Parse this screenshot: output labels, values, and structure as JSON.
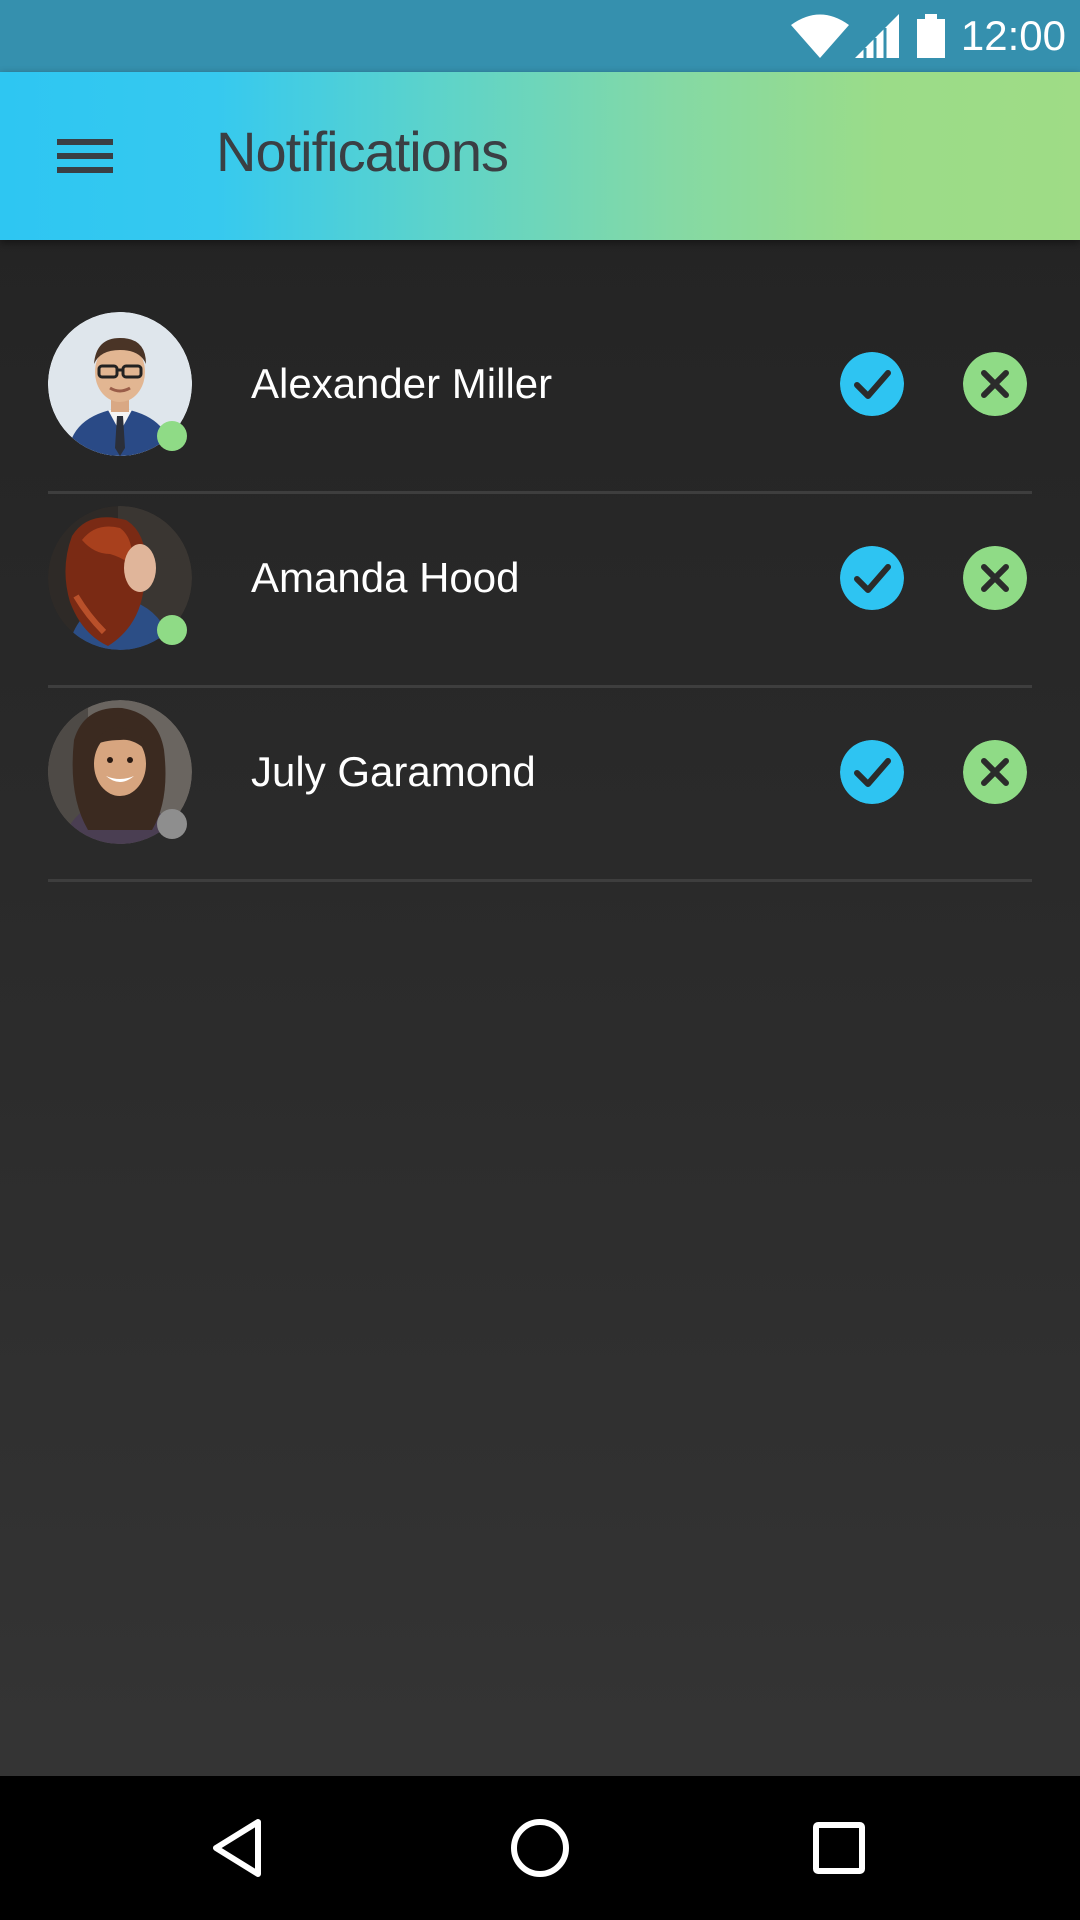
{
  "status_bar": {
    "time": "12:00",
    "icons": [
      "wifi-icon",
      "cell-signal-icon",
      "battery-icon"
    ]
  },
  "app_bar": {
    "title": "Notifications",
    "menu_icon": "hamburger-menu-icon"
  },
  "colors": {
    "accept": "#2ec4f2",
    "decline": "#8fdb86",
    "online": "#8fdb86",
    "offline": "#8e8e8e",
    "icon_mark": "#2b2b2b"
  },
  "requests": [
    {
      "name": "Alexander Miller",
      "status": "online",
      "accept_icon": "check-icon",
      "decline_icon": "close-icon"
    },
    {
      "name": "Amanda Hood",
      "status": "online",
      "accept_icon": "check-icon",
      "decline_icon": "close-icon"
    },
    {
      "name": "July Garamond",
      "status": "offline",
      "accept_icon": "check-icon",
      "decline_icon": "close-icon"
    }
  ],
  "nav_bar": {
    "icons": [
      "back-icon",
      "home-icon",
      "recents-icon"
    ]
  }
}
